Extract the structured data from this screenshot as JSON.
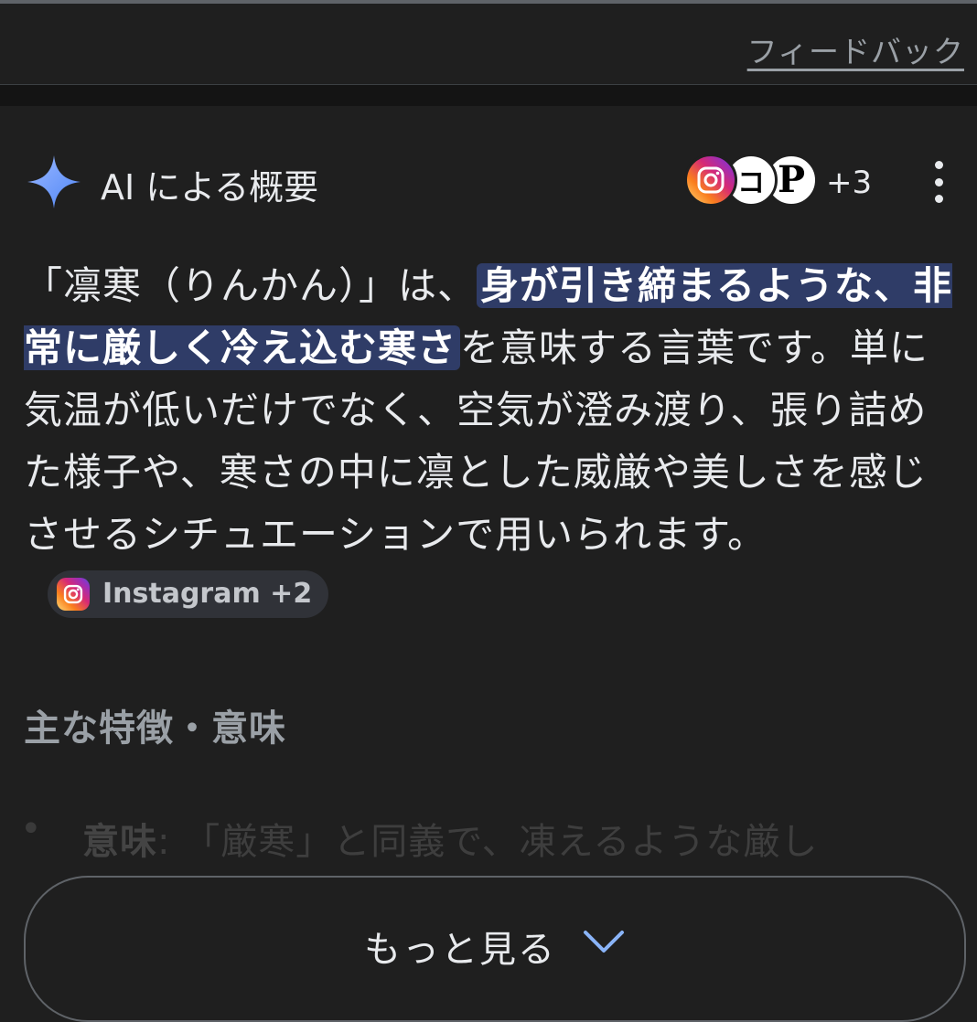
{
  "top": {
    "feedback_label": "フィードバック"
  },
  "ai_overview": {
    "title": "AI による概要",
    "sources_more": "+3",
    "paragraph": {
      "before": "「凛寒（りんかん）」は、",
      "highlight": "身が引き締まるような、非常に厳しく冷え込む寒さ",
      "after": "を意味する言葉です。単に気温が低いだけでなく、空気が澄み渡り、張り詰めた様子や、寒さの中に凛とした威厳や美しさを感じさせるシチュエーションで用いられます。"
    },
    "citation_chip": "Instagram +2",
    "subheading": "主な特徴・意味",
    "bullet": {
      "label": "意味",
      "text": ": 「厳寒」と同義で、凍えるような厳し"
    },
    "show_more_label": "もっと見る"
  },
  "colors": {
    "background": "#1f1f1f",
    "highlight": "#2f3c67",
    "chevron": "#8ab4f8"
  }
}
